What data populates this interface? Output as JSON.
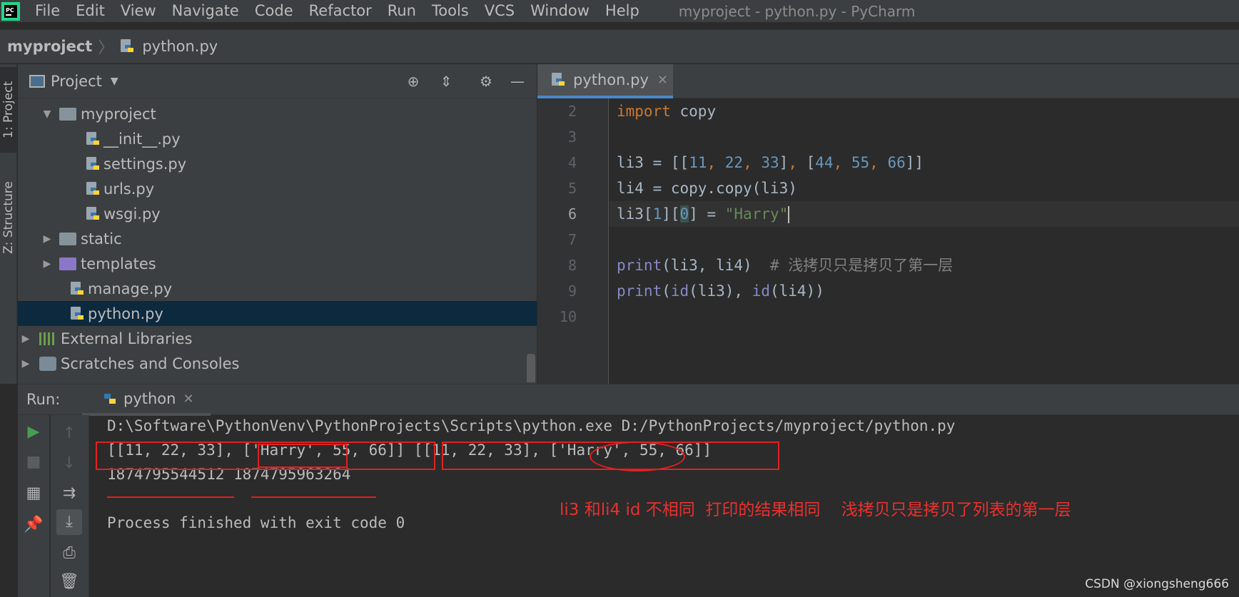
{
  "menubar": {
    "items": [
      "File",
      "Edit",
      "View",
      "Navigate",
      "Code",
      "Refactor",
      "Run",
      "Tools",
      "VCS",
      "Window",
      "Help"
    ],
    "window_title": "myproject - python.py - PyCharm"
  },
  "breadcrumb": {
    "project": "myproject",
    "file": "python.py"
  },
  "tool_strip": {
    "project_tab": "1: Project",
    "structure_tab": "Z: Structure"
  },
  "project_panel": {
    "title": "Project",
    "tree": [
      {
        "label": "myproject"
      },
      {
        "label": "__init__.py"
      },
      {
        "label": "settings.py"
      },
      {
        "label": "urls.py"
      },
      {
        "label": "wsgi.py"
      },
      {
        "label": "static"
      },
      {
        "label": "templates"
      },
      {
        "label": "manage.py"
      },
      {
        "label": "python.py"
      },
      {
        "label": "External Libraries"
      },
      {
        "label": "Scratches and Consoles"
      }
    ]
  },
  "editor": {
    "tab_label": "python.py",
    "line_numbers": [
      "2",
      "3",
      "4",
      "5",
      "6",
      "7",
      "8",
      "9",
      "10"
    ],
    "code": {
      "l2": {
        "kw": "import",
        "name": "copy"
      },
      "l4": {
        "var": "li3",
        "op": "=",
        "a1": "11",
        "a2": "22",
        "a3": "33",
        "b1": "44",
        "b2": "55",
        "b3": "66"
      },
      "l5": {
        "text": "li4 = copy.copy(li3)"
      },
      "l6": {
        "pre": "li3[",
        "i1": "1",
        "mid": "][",
        "i0": "0",
        "post": "] = ",
        "str": "\"Harry\""
      },
      "l8": {
        "fn": "print",
        "args": "(li3, li4)",
        "comment": "# 浅拷贝只是拷贝了第一层"
      },
      "l9": {
        "fn": "print",
        "id1": "id",
        "a1": "(li3), ",
        "id2": "id",
        "a2": "(li4))"
      }
    }
  },
  "run_panel": {
    "label": "Run:",
    "tab_label": "python",
    "console": [
      "D:\\Software\\PythonVenv\\PythonProjects\\Scripts\\python.exe D:/PythonProjects/myproject/python.py",
      "[[11, 22, 33], ['Harry', 55, 66]] [[11, 22, 33], ['Harry', 55, 66]]",
      "1874795544512 1874795963264",
      "",
      "Process finished with exit code 0"
    ]
  },
  "annotation": "li3 和li4 id 不相同  打印的结果相同    浅拷贝只是拷贝了列表的第一层",
  "watermark": "CSDN @xiongsheng666",
  "colors": {
    "accent": "#4a88c7",
    "annotation_red": "#e02020",
    "selected_row": "#0d293e"
  }
}
